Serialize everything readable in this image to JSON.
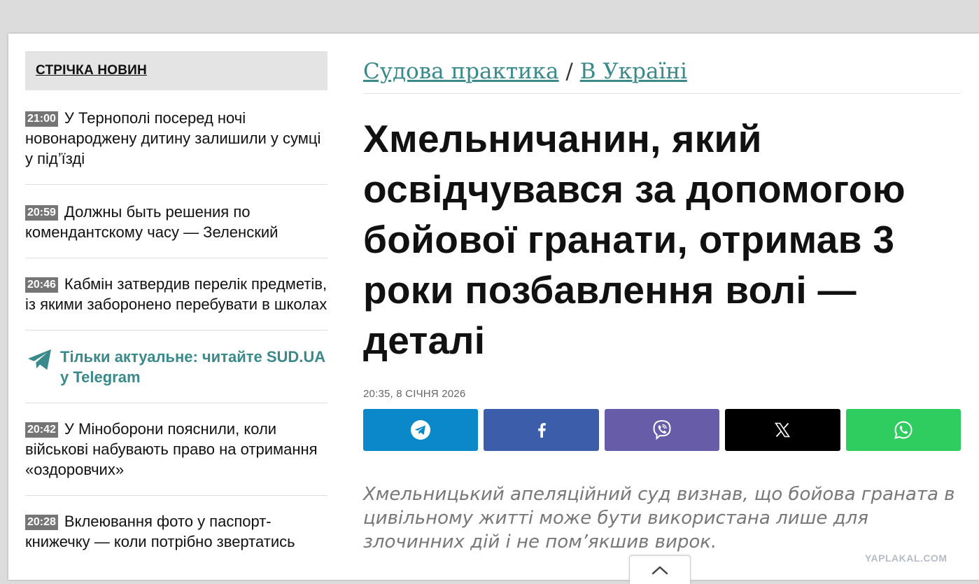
{
  "sidebar": {
    "header_label": "СТРІЧКА НОВИН",
    "items": [
      {
        "time": "21:00",
        "text": "У Тернополі посеред ночі новонароджену дитину залишили у сумці у під’їзді"
      },
      {
        "time": "20:59",
        "text": "Должны быть решения по комендантскому часу — Зеленский"
      },
      {
        "time": "20:46",
        "text": "Кабмін затвердив перелік предметів, із якими заборонено перебувати в школах"
      }
    ],
    "telegram_promo": "Тільки актуальне: читайте SUD.UA у Telegram",
    "items_after": [
      {
        "time": "20:42",
        "text": "У Міноборони пояснили, коли військові набувають право на отримання «оздоровчих»"
      },
      {
        "time": "20:28",
        "text": "Вклеювання фото у паспорт-книжечку — коли потрібно звертатись"
      }
    ]
  },
  "breadcrumb": {
    "section": "Судова практика",
    "separator": "/",
    "subsection": "В Україні"
  },
  "article": {
    "headline": "Хмельничанин, який освідчувався за допомогою бойової гранати, отримав 3 роки позбавлення волі — деталі",
    "date": "20:35, 8 СІЧНЯ 2026",
    "lead": "Хмельницький апеляційний суд визнав, що бойова граната в цивільному житті може бути використана лише для злочинних дій і не пом’якшив вирок."
  },
  "share_buttons": [
    {
      "network": "telegram",
      "icon": "telegram-icon",
      "color": "#0a88c9"
    },
    {
      "network": "facebook",
      "icon": "facebook-icon",
      "color": "#3b5daa"
    },
    {
      "network": "viber",
      "icon": "viber-icon",
      "color": "#665ca7"
    },
    {
      "network": "x",
      "icon": "x-icon",
      "color": "#000000"
    },
    {
      "network": "whatsapp",
      "icon": "whatsapp-icon",
      "color": "#2fcc5f"
    }
  ],
  "colors": {
    "accent": "#3a8a8c",
    "time_badge": "#757575",
    "sidebar_header_bg": "#e4e4e4"
  },
  "watermark": "YAPLAKAL.COM"
}
